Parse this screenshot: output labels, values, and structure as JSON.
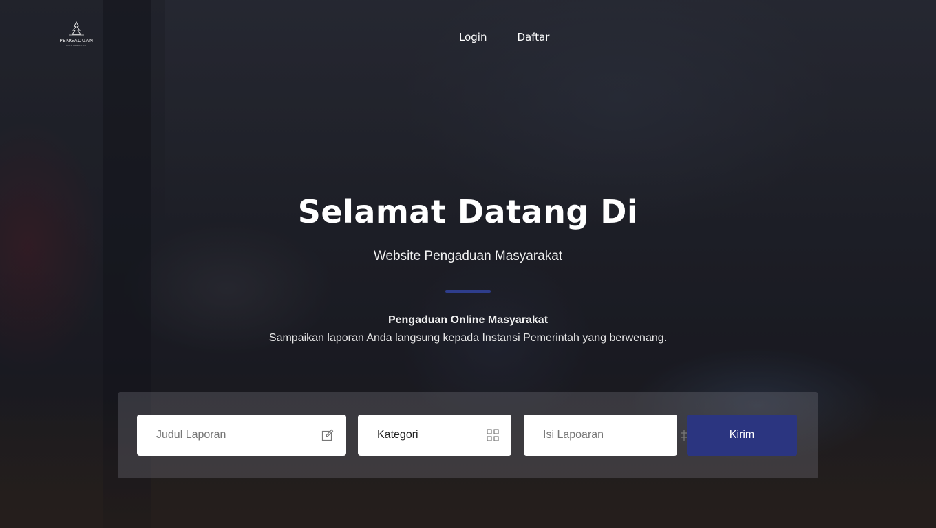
{
  "brand": {
    "logo_text": "PENGADUAN",
    "logo_sub": "MASYARAKAT"
  },
  "nav": {
    "login": "Login",
    "register": "Daftar"
  },
  "hero": {
    "title": "Selamat Datang Di",
    "subtitle": "Website Pengaduan Masyarakat",
    "desc_title": "Pengaduan Online Masyarakat",
    "desc_text": "Sampaikan laporan Anda langsung kepada Instansi Pemerintah yang berwenang."
  },
  "form": {
    "title_placeholder": "Judul Laporan",
    "category_value": "Kategori",
    "content_placeholder": "Isi Lapoaran",
    "submit_label": "Kirim",
    "submit_color": "#2b3580"
  },
  "icons": {
    "title_field": "edit-icon",
    "category_field": "grid-icon",
    "content_field": "hashtag-icon"
  }
}
